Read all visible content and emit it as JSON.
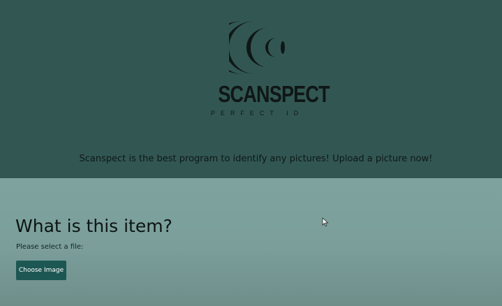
{
  "brand": {
    "name": "SCANSPECT",
    "slogan": "PERFECT ID"
  },
  "hero": {
    "tagline": "Scanspect is the best program to identify any pictures! Upload a picture now!"
  },
  "upload": {
    "heading": "What is this item?",
    "file_label": "Please select a file:",
    "button_label": "Choose Image"
  },
  "colors": {
    "hero_background": "#325753",
    "content_background": "#7ea39f",
    "button_background": "#1d5753",
    "logo": "#0f1716"
  }
}
